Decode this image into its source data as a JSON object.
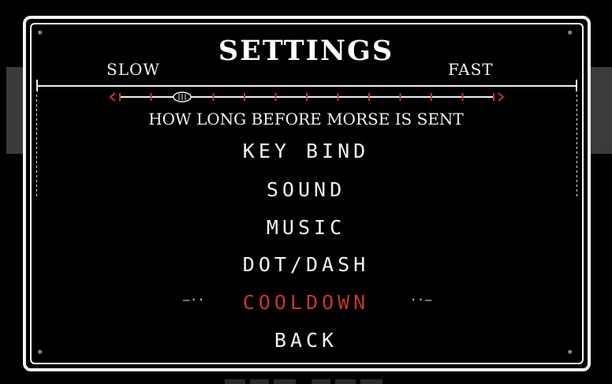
{
  "settings": {
    "title": "SETTINGS",
    "slider": {
      "min_label": "SLOW",
      "max_label": "FAST",
      "description": "HOW LONG BEFORE MORSE IS SENT",
      "steps": 13,
      "value_step": 2
    },
    "menu": [
      {
        "label": "KEY BIND",
        "selected": false
      },
      {
        "label": "SOUND",
        "selected": false
      },
      {
        "label": "MUSIC",
        "selected": false
      },
      {
        "label": "DOT/DASH",
        "selected": false
      },
      {
        "label": "COOLDOWN",
        "selected": true
      },
      {
        "label": "BACK",
        "selected": false
      }
    ],
    "colors": {
      "accent": "#c0392b",
      "text": "#f2f2f2",
      "background": "#000000",
      "backdrop_gray": "#3b3b3b"
    }
  }
}
